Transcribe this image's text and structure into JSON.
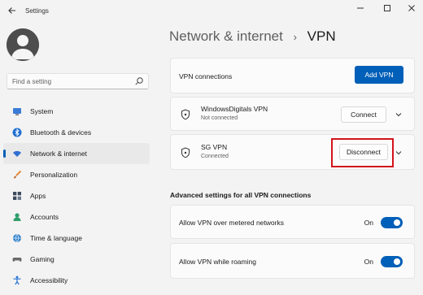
{
  "window": {
    "app_title": "Settings",
    "back_icon": "arrow-left-icon",
    "controls": [
      "minimize-icon",
      "maximize-icon",
      "close-icon"
    ]
  },
  "sidebar": {
    "search": {
      "placeholder": "Find a setting",
      "value": ""
    },
    "items": [
      {
        "label": "System",
        "icon": "monitor-icon",
        "selected": false
      },
      {
        "label": "Bluetooth & devices",
        "icon": "bluetooth-icon",
        "selected": false
      },
      {
        "label": "Network & internet",
        "icon": "wifi-icon",
        "selected": true
      },
      {
        "label": "Personalization",
        "icon": "brush-icon",
        "selected": false
      },
      {
        "label": "Apps",
        "icon": "apps-icon",
        "selected": false
      },
      {
        "label": "Accounts",
        "icon": "person-icon",
        "selected": false
      },
      {
        "label": "Time & language",
        "icon": "globe-icon",
        "selected": false
      },
      {
        "label": "Gaming",
        "icon": "controller-icon",
        "selected": false
      },
      {
        "label": "Accessibility",
        "icon": "accessibility-icon",
        "selected": false
      }
    ]
  },
  "header": {
    "parent": "Network & internet",
    "separator": "›",
    "current": "VPN"
  },
  "vpn_connections": {
    "label": "VPN connections",
    "add_button": "Add VPN",
    "list": [
      {
        "name": "WindowsDigitals VPN",
        "status": "Not connected",
        "action": "Connect"
      },
      {
        "name": "SG VPN",
        "status": "Connected",
        "action": "Disconnect"
      }
    ]
  },
  "advanced": {
    "heading": "Advanced settings for all VPN connections",
    "settings": [
      {
        "label": "Allow VPN over metered networks",
        "state": "On"
      },
      {
        "label": "Allow VPN while roaming",
        "state": "On"
      }
    ]
  },
  "colors": {
    "accent": "#005fb8",
    "highlight_annotation": "#d3141b",
    "background": "#f3f3f3",
    "card": "#fbfbfb"
  }
}
